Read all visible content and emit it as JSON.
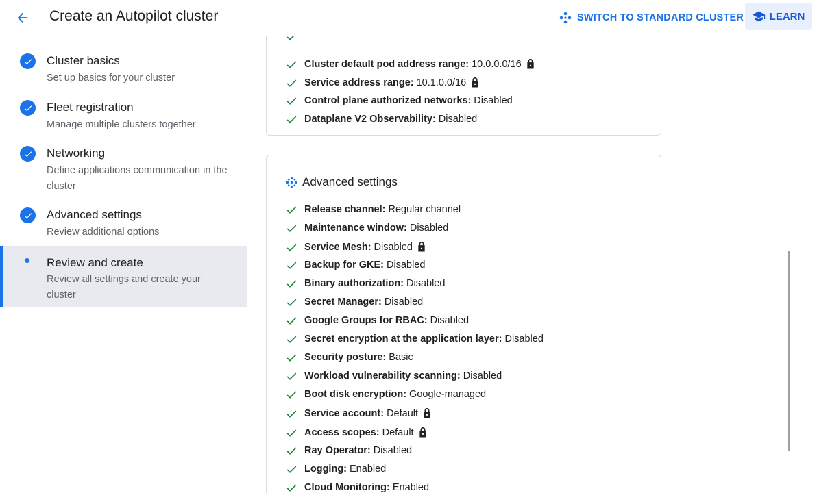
{
  "header": {
    "title": "Create an Autopilot cluster",
    "switch_label": "SWITCH TO STANDARD CLUSTER",
    "learn_label": "LEARN"
  },
  "sidebar": {
    "steps": [
      {
        "title": "Cluster basics",
        "subtitle": "Set up basics for your cluster",
        "state": "complete"
      },
      {
        "title": "Fleet registration",
        "subtitle": "Manage multiple clusters together",
        "state": "complete"
      },
      {
        "title": "Networking",
        "subtitle": "Define applications communication in the cluster",
        "state": "complete"
      },
      {
        "title": "Advanced settings",
        "subtitle": "Review additional options",
        "state": "complete"
      },
      {
        "title": "Review and create",
        "subtitle": "Review all settings and create your cluster",
        "state": "current"
      }
    ]
  },
  "networking_card": {
    "rows": [
      {
        "label": "Cluster default pod address range:",
        "value": "10.0.0.0/16",
        "locked": true
      },
      {
        "label": "Service address range:",
        "value": "10.1.0.0/16",
        "locked": true
      },
      {
        "label": "Control plane authorized networks:",
        "value": "Disabled",
        "locked": false
      },
      {
        "label": "Dataplane V2 Observability:",
        "value": "Disabled",
        "locked": false
      }
    ]
  },
  "advanced_card": {
    "title": "Advanced settings",
    "rows": [
      {
        "label": "Release channel:",
        "value": "Regular channel",
        "locked": false
      },
      {
        "label": "Maintenance window:",
        "value": "Disabled",
        "locked": false
      },
      {
        "label": "Service Mesh:",
        "value": "Disabled",
        "locked": true
      },
      {
        "label": "Backup for GKE:",
        "value": "Disabled",
        "locked": false
      },
      {
        "label": "Binary authorization:",
        "value": "Disabled",
        "locked": false
      },
      {
        "label": "Secret Manager:",
        "value": "Disabled",
        "locked": false
      },
      {
        "label": "Google Groups for RBAC:",
        "value": "Disabled",
        "locked": false
      },
      {
        "label": "Secret encryption at the application layer:",
        "value": "Disabled",
        "locked": false
      },
      {
        "label": "Security posture:",
        "value": "Basic",
        "locked": false
      },
      {
        "label": "Workload vulnerability scanning:",
        "value": "Disabled",
        "locked": false
      },
      {
        "label": "Boot disk encryption:",
        "value": "Google-managed",
        "locked": false
      },
      {
        "label": "Service account:",
        "value": "Default",
        "locked": true
      },
      {
        "label": "Access scopes:",
        "value": "Default",
        "locked": true
      },
      {
        "label": "Ray Operator:",
        "value": "Disabled",
        "locked": false
      },
      {
        "label": "Logging:",
        "value": "Enabled",
        "locked": false
      },
      {
        "label": "Cloud Monitoring:",
        "value": "Enabled",
        "locked": false
      }
    ]
  },
  "colors": {
    "accent": "#1a73e8",
    "check": "#188038"
  }
}
